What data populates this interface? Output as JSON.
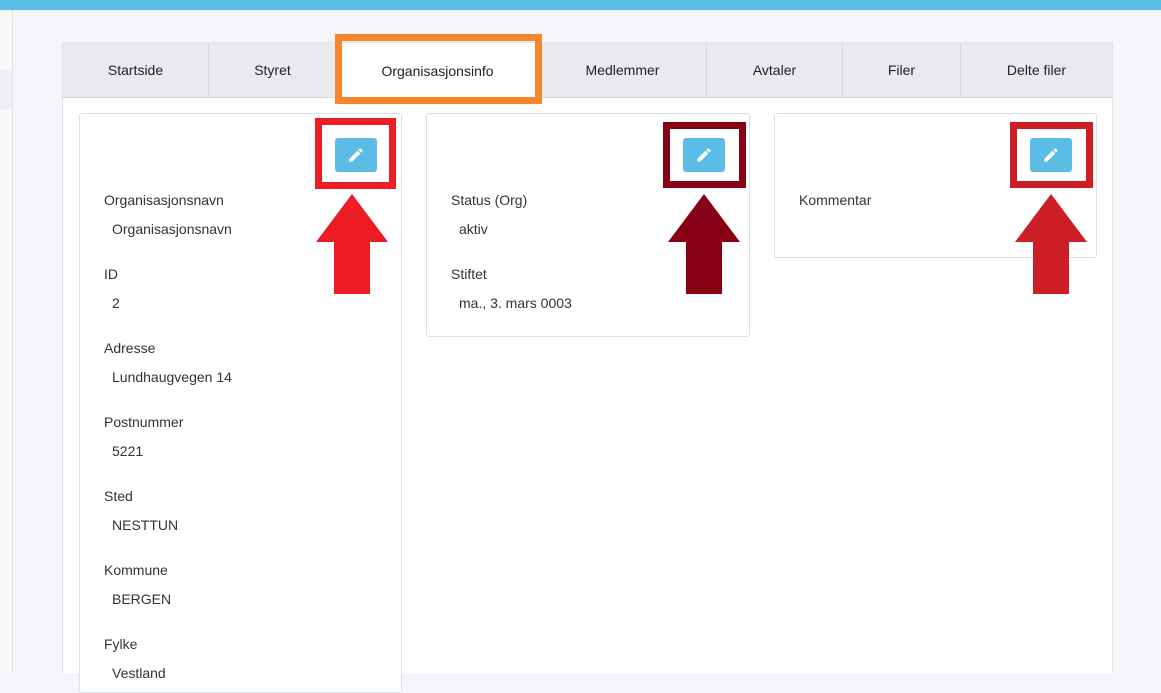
{
  "tabs": [
    {
      "label": "Startside"
    },
    {
      "label": "Styret"
    },
    {
      "label": "Organisasjonsinfo"
    },
    {
      "label": "Medlemmer"
    },
    {
      "label": "Avtaler"
    },
    {
      "label": "Filer"
    },
    {
      "label": "Delte filer"
    }
  ],
  "active_tab": "Organisasjonsinfo",
  "card1": {
    "fields": [
      {
        "label": "Organisasjonsnavn",
        "value": "Organisasjonsnavn"
      },
      {
        "label": "ID",
        "value": "2"
      },
      {
        "label": "Adresse",
        "value": "Lundhaugvegen 14"
      },
      {
        "label": "Postnummer",
        "value": "5221"
      },
      {
        "label": "Sted",
        "value": "NESTTUN"
      },
      {
        "label": "Kommune",
        "value": "BERGEN"
      },
      {
        "label": "Fylke",
        "value": "Vestland"
      }
    ]
  },
  "card2": {
    "fields": [
      {
        "label": "Status (Org)",
        "value": "aktiv"
      },
      {
        "label": "Stiftet",
        "value": "ma., 3. mars 0003"
      }
    ]
  },
  "card3": {
    "fields": [
      {
        "label": "Kommentar",
        "value": ""
      }
    ]
  },
  "colors": {
    "accent": "#5bbde6",
    "tab_highlight": "#f7852a",
    "marker_red": "#ee1c25",
    "marker_dark_red": "#880015",
    "marker_mid_red": "#cc1f25"
  },
  "icons": {
    "edit": "pencil-icon"
  }
}
